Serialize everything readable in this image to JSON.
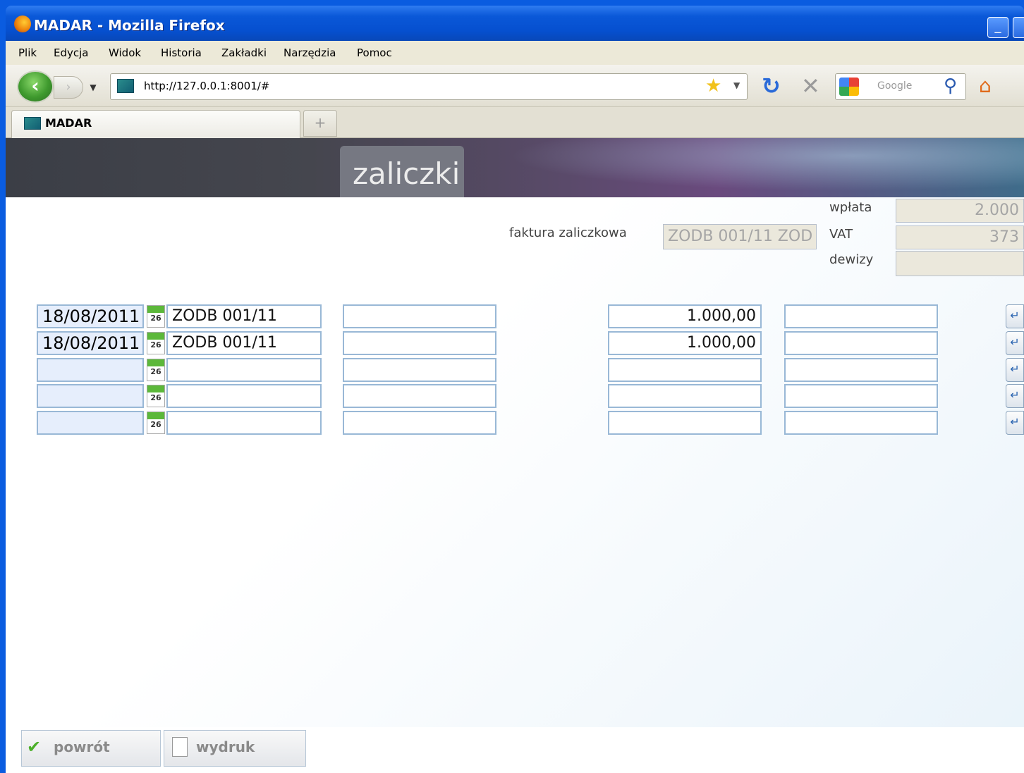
{
  "window": {
    "title": "MADAR - Mozilla Firefox"
  },
  "menubar": {
    "items": [
      "Plik",
      "Edycja",
      "Widok",
      "Historia",
      "Zakładki",
      "Narzędzia",
      "Pomoc"
    ]
  },
  "navbar": {
    "url": "http://127.0.0.1:8001/#",
    "search_placeholder": "Google"
  },
  "tabs": [
    {
      "label": "MADAR"
    }
  ],
  "page": {
    "header_title": "zaliczki",
    "invoice_label": "faktura zaliczkowa",
    "invoice_value": "ZODB 001/11 ZOD",
    "summary": [
      {
        "label": "wpłata",
        "value": "2.000"
      },
      {
        "label": "VAT",
        "value": "373"
      },
      {
        "label": "dewizy",
        "value": ""
      }
    ],
    "rows": [
      {
        "date": "18/08/2011",
        "doc": "ZODB 001/11",
        "col3": "",
        "amount": "1.000,00",
        "col5": ""
      },
      {
        "date": "18/08/2011",
        "doc": "ZODB 001/11",
        "col3": "",
        "amount": "1.000,00",
        "col5": ""
      },
      {
        "date": "",
        "doc": "",
        "col3": "",
        "amount": "",
        "col5": ""
      },
      {
        "date": "",
        "doc": "",
        "col3": "",
        "amount": "",
        "col5": ""
      },
      {
        "date": "",
        "doc": "",
        "col3": "",
        "amount": "",
        "col5": ""
      }
    ],
    "calendar_day": "26",
    "buttons": {
      "back": "powrót",
      "print": "wydruk"
    }
  },
  "icons": {
    "back": "arrow-left-icon",
    "forward": "arrow-right-icon",
    "bookmark": "star-icon",
    "reload": "reload-icon",
    "stop": "stop-icon",
    "search": "magnifier-icon",
    "home": "home-icon",
    "calendar": "calendar-icon",
    "row_action": "enter-arrow-icon",
    "ok": "checkmark-icon",
    "print": "document-icon"
  }
}
